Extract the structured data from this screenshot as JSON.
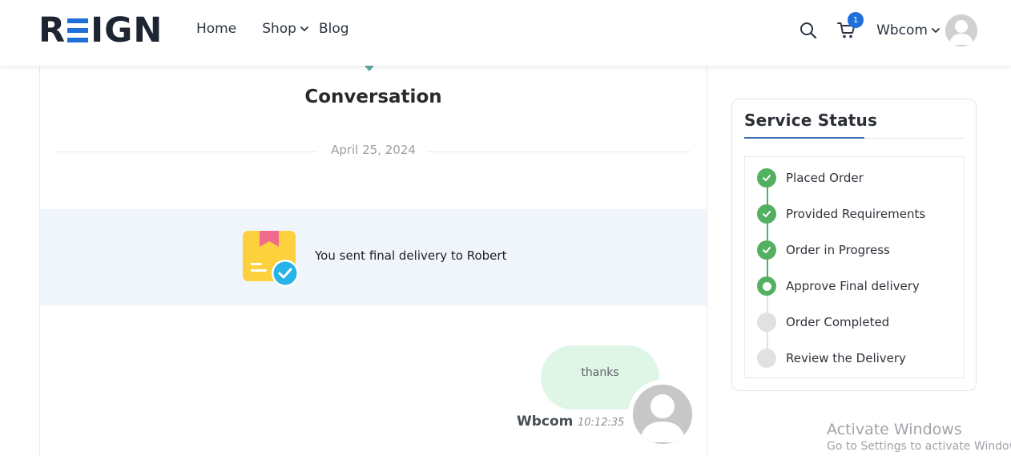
{
  "header": {
    "logo_text": "REIGN",
    "nav": [
      {
        "label": "Home"
      },
      {
        "label": "Shop"
      },
      {
        "label": "Blog"
      }
    ],
    "cart_count": "1",
    "user_name": "Wbcom",
    "icons": {
      "search": "search-icon",
      "cart": "cart-icon",
      "user_dropdown": "chevron-down-icon",
      "avatar": "user-avatar-icon"
    },
    "brand_color": "#1e6fd9"
  },
  "conversation": {
    "title": "Conversation",
    "date": "April 25, 2024",
    "delivery_notice": {
      "text": "You sent final delivery to Robert",
      "icon": "delivery-box-check-icon",
      "background_color": "#f0f5fb"
    },
    "messages": [
      {
        "text": "thanks",
        "sender": "Wbcom",
        "time": "10:12:35",
        "bubble_color": "#dff5e6"
      }
    ]
  },
  "service_status": {
    "title": "Service Status",
    "steps": [
      {
        "label": "Placed Order",
        "state": "done"
      },
      {
        "label": "Provided Requirements",
        "state": "done"
      },
      {
        "label": "Order in Progress",
        "state": "done"
      },
      {
        "label": "Approve Final delivery",
        "state": "current"
      },
      {
        "label": "Order Completed",
        "state": "pending"
      },
      {
        "label": "Review the Delivery",
        "state": "pending"
      }
    ],
    "colors": {
      "done": "#52b060",
      "pending": "#e1e1e1",
      "accent": "#3a6fb4"
    }
  },
  "watermark": {
    "title": "Activate Windows",
    "subtitle": "Go to Settings to activate Windows."
  }
}
